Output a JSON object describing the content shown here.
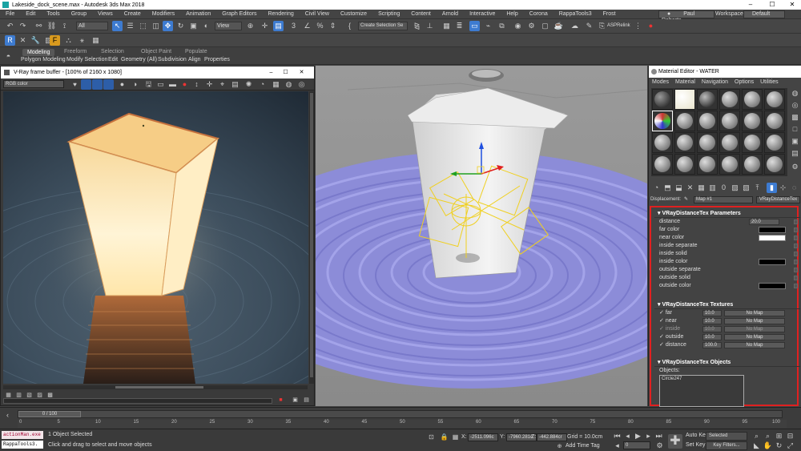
{
  "window": {
    "title": "Lakeside_dock_scene.max - Autodesk 3ds Max 2018",
    "min": "–",
    "max": "☐",
    "close": "✕"
  },
  "menu": [
    "File",
    "Edit",
    "Tools",
    "Group",
    "Views",
    "Create",
    "Modifiers",
    "Animation",
    "Graph Editors",
    "Rendering",
    "Civil View",
    "Customize",
    "Scripting",
    "Content",
    "Arnold",
    "Interactive",
    "Help",
    "Corona",
    "RappaTools3",
    "Frost"
  ],
  "user": {
    "name": "Paul Roberts",
    "workspaces_label": "Workspaces:",
    "workspace": "Default"
  },
  "toolbar": {
    "filter": "All",
    "coord_system": "View",
    "selection_set": "Create Selection Se",
    "asp": "ASPRelink"
  },
  "ribbon": {
    "tabs": [
      "Modeling",
      "Freeform",
      "Selection",
      "Object Paint",
      "Populate"
    ],
    "subs": [
      "Polygon Modeling",
      "Modify Selection",
      "Edit",
      "Geometry (All)",
      "Subdivision",
      "Align",
      "Properties"
    ]
  },
  "vfb": {
    "title": "V-Ray frame buffer - [100% of 2160 x 1080]",
    "channel": "RGB color",
    "min": "–",
    "max": "☐",
    "close": "✕"
  },
  "material_editor": {
    "title": "Material Editor - WATER",
    "menu": [
      "Modes",
      "Material",
      "Navigation",
      "Options",
      "Utilities"
    ],
    "displacement_label": "Displacement:",
    "map_name": "Map #1",
    "map_type": "VRayDistanceTex",
    "params": {
      "header": "VRayDistanceTex Parameters",
      "distance_label": "distance",
      "distance_value": "20.0",
      "far_color": "far color",
      "near_color": "near color",
      "inside_separate": "inside separate",
      "inside_solid": "inside solid",
      "inside_color": "inside color",
      "outside_separate": "outside separate",
      "outside_solid": "outside solid",
      "outside_color": "outside color"
    },
    "textures": {
      "header": "VRayDistanceTex Textures",
      "rows": [
        {
          "label": "far",
          "value": "10.0",
          "map": "No Map"
        },
        {
          "label": "near",
          "value": "10.0",
          "map": "No Map"
        },
        {
          "label": "inside",
          "value": "10.0",
          "map": "No Map"
        },
        {
          "label": "outside",
          "value": "10.0",
          "map": "No Map"
        },
        {
          "label": "distance",
          "value": "100.0",
          "map": "No Map"
        }
      ]
    },
    "objects": {
      "header": "VRayDistanceTex Objects",
      "label": "Objects:",
      "items": [
        "Circle247"
      ]
    }
  },
  "timeline": {
    "frame": "0 / 100",
    "ticks": [
      "0",
      "5",
      "10",
      "15",
      "20",
      "25",
      "30",
      "35",
      "40",
      "45",
      "50",
      "55",
      "60",
      "65",
      "70",
      "75",
      "80",
      "85",
      "90",
      "95",
      "100"
    ]
  },
  "status": {
    "listener1": "actionMan.exe",
    "listener2": "RappaTools3.",
    "selected": "1 Object Selected",
    "hint": "Click and drag to select and move objects",
    "x_label": "X:",
    "x": "-2511.096c",
    "y_label": "Y:",
    "y": "-7960.281c",
    "z_label": "Z:",
    "z": "-442.884cr",
    "grid": "Grid = 10.0cm",
    "add_time_tag": "Add Time Tag",
    "auto_key": "Auto Key",
    "set_key": "Set Key",
    "key_mode": "Selected",
    "key_filters": "Key Filters...",
    "frame_field": "0"
  },
  "colors": {
    "selection_red": "#e02020",
    "lamp_glow": "#ffe8b0",
    "water_tint": "#8c8cd8",
    "gizmo": "#f0d020"
  }
}
